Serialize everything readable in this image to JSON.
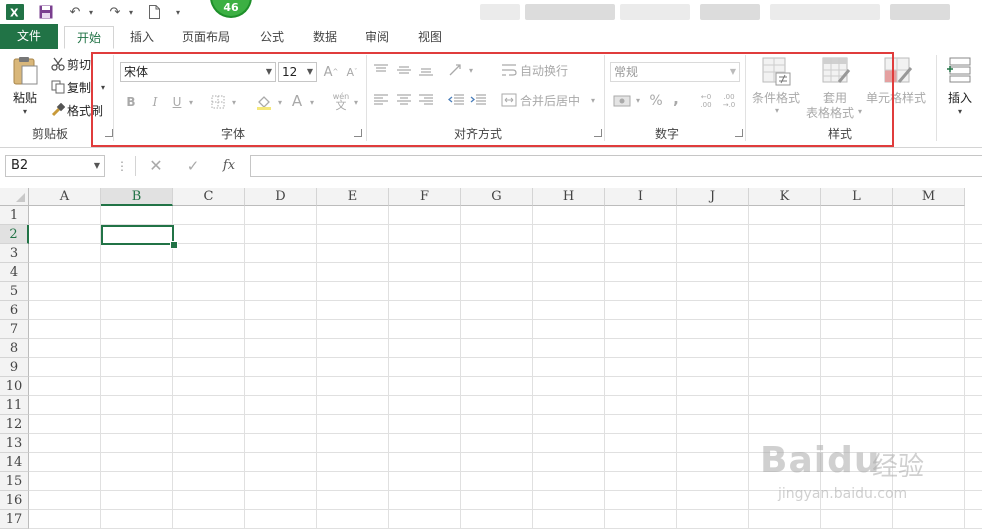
{
  "qat": {
    "app_icon": "excel-icon",
    "save_icon": "save-icon",
    "undo_icon": "undo-icon",
    "redo_icon": "redo-icon",
    "new_icon": "new-document-icon",
    "customize_icon": "dropdown-icon",
    "badge_count": "46"
  },
  "tabs": [
    "文件",
    "开始",
    "插入",
    "页面布局",
    "公式",
    "数据",
    "审阅",
    "视图"
  ],
  "clipboard": {
    "paste": "粘贴",
    "cut": "剪切",
    "copy": "复制",
    "format_painter": "格式刷",
    "label": "剪贴板"
  },
  "font": {
    "name": "宋体",
    "size": "12",
    "bold": "B",
    "italic": "I",
    "underline": "U",
    "font_color": "A",
    "label": "字体"
  },
  "alignment": {
    "wrap_text": "自动换行",
    "merge_center": "合并后居中",
    "label": "对齐方式"
  },
  "number": {
    "format": "常规",
    "percent": "%",
    "comma": ",",
    "label": "数字"
  },
  "styles": {
    "conditional": "条件格式",
    "table_format_1": "套用",
    "table_format_2": "表格格式",
    "cell_styles": "单元格样式",
    "label": "样式"
  },
  "cells": {
    "insert": "插入"
  },
  "formula_bar": {
    "name_box": "B2",
    "fx": "fx"
  },
  "sheet": {
    "columns": [
      "A",
      "B",
      "C",
      "D",
      "E",
      "F",
      "G",
      "H",
      "I",
      "J",
      "K",
      "L",
      "M"
    ],
    "rows": [
      "1",
      "2",
      "3",
      "4",
      "5",
      "6",
      "7",
      "8",
      "9",
      "10",
      "11",
      "12",
      "13",
      "14",
      "15",
      "16",
      "17"
    ],
    "active_cell": "B2"
  },
  "watermark": {
    "brand": "Baidu",
    "cn": "经验",
    "url": "jingyan.baidu.com"
  },
  "colors": {
    "accent": "#217346",
    "highlight": "#e03c3c",
    "badge": "#3cb043"
  }
}
